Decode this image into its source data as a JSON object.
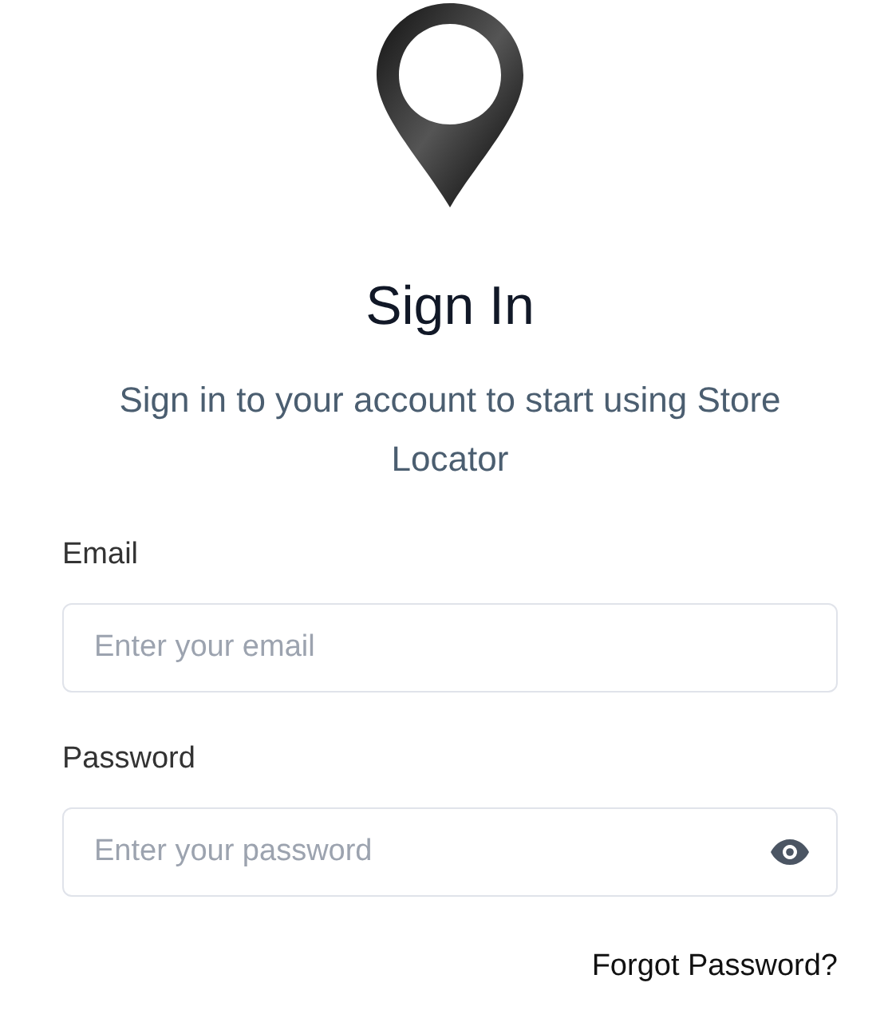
{
  "title": "Sign In",
  "subtitle": "Sign in to your account to start using Store Locator",
  "fields": [
    {
      "label": "Email",
      "placeholder": "Enter your email",
      "kind": "text"
    },
    {
      "label": "Password",
      "placeholder": "Enter your password",
      "kind": "password"
    }
  ],
  "forgot_link": "Forgot Password?"
}
